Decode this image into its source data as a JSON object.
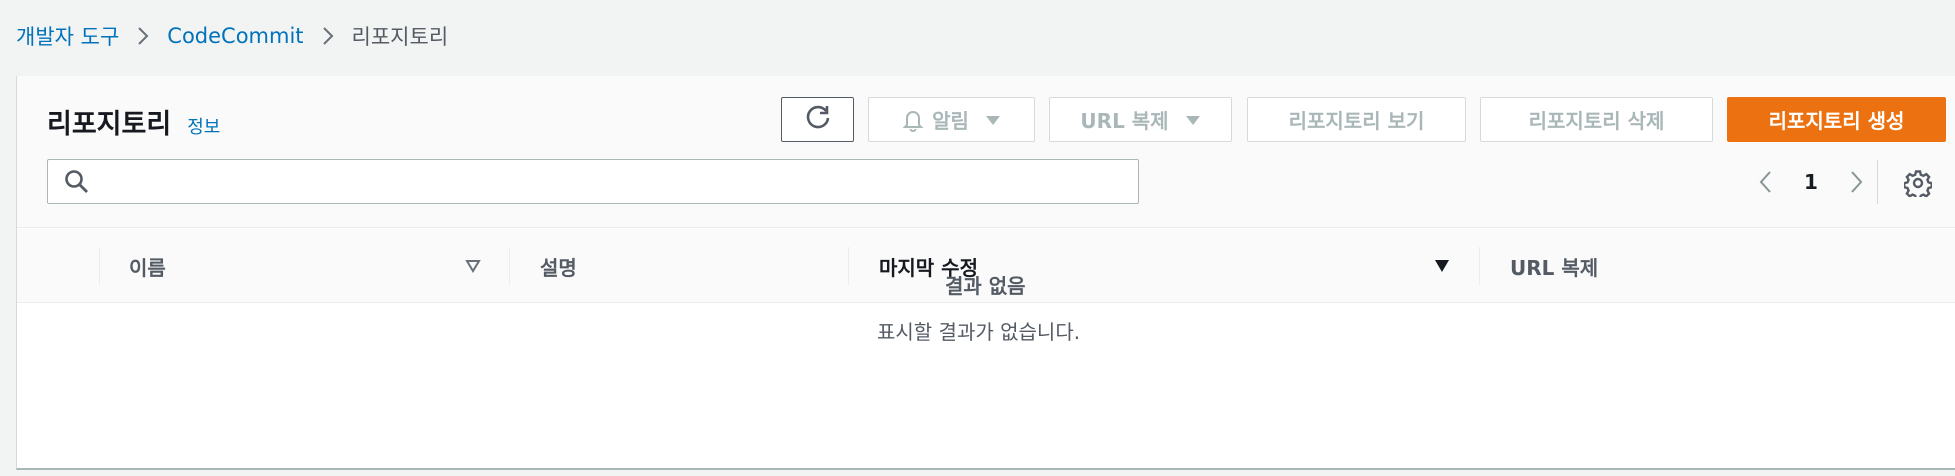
{
  "breadcrumb": {
    "items": [
      "개발자 도구",
      "CodeCommit",
      "리포지토리"
    ]
  },
  "header": {
    "title": "리포지토리",
    "info_label": "정보"
  },
  "toolbar": {
    "refresh_icon": "refresh-icon",
    "notify_label": "알림",
    "url_clone_label": "URL 복제",
    "view_label": "리포지토리 보기",
    "delete_label": "리포지토리 삭제",
    "create_label": "리포지토리 생성"
  },
  "search": {
    "value": "",
    "placeholder": ""
  },
  "pagination": {
    "current_page": "1"
  },
  "table": {
    "columns": [
      "이름",
      "설명",
      "마지막 수정",
      "URL 복제"
    ],
    "rows": [],
    "empty_title": "결과 없음",
    "empty_message": "표시할 결과가 없습니다."
  },
  "colors": {
    "primary": "#ec7211",
    "link": "#0073bb",
    "disabled": "#aab7b8"
  }
}
